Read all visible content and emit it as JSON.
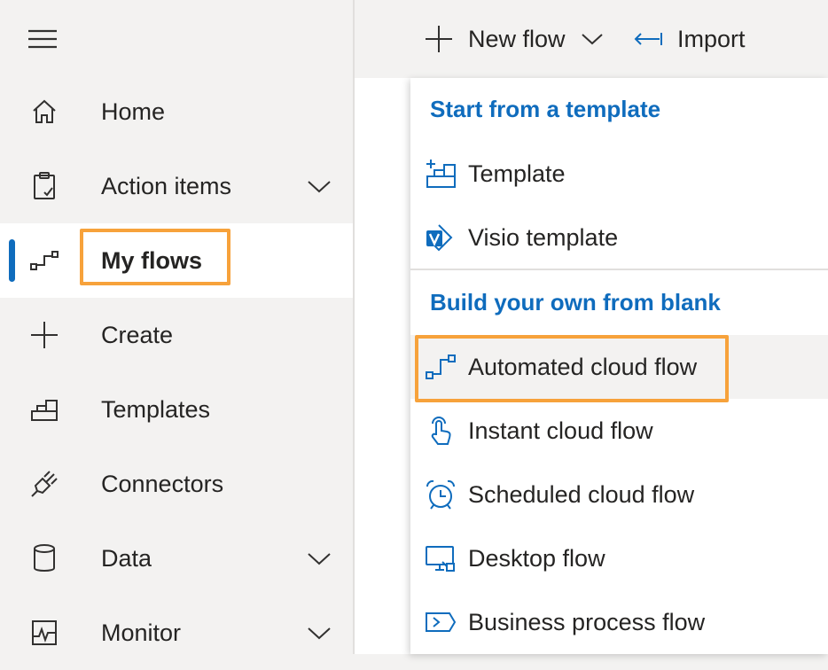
{
  "command_bar": {
    "new_flow_label": "New flow",
    "import_label": "Import"
  },
  "sidebar": {
    "items": [
      {
        "label": "Home",
        "icon": "home-icon"
      },
      {
        "label": "Action items",
        "icon": "clipboard-icon",
        "expandable": true
      },
      {
        "label": "My flows",
        "icon": "flow-icon",
        "active": true
      },
      {
        "label": "Create",
        "icon": "plus-icon"
      },
      {
        "label": "Templates",
        "icon": "templates-icon"
      },
      {
        "label": "Connectors",
        "icon": "plug-icon"
      },
      {
        "label": "Data",
        "icon": "database-icon",
        "expandable": true
      },
      {
        "label": "Monitor",
        "icon": "monitor-icon",
        "expandable": true
      }
    ]
  },
  "new_flow_menu": {
    "template_heading": "Start from a template",
    "template_items": [
      {
        "label": "Template",
        "icon": "template-icon"
      },
      {
        "label": "Visio template",
        "icon": "visio-icon"
      }
    ],
    "blank_heading": "Build your own from blank",
    "blank_items": [
      {
        "label": "Automated cloud flow",
        "icon": "automated-flow-icon",
        "highlighted": true
      },
      {
        "label": "Instant cloud flow",
        "icon": "touch-icon"
      },
      {
        "label": "Scheduled cloud flow",
        "icon": "alarm-clock-icon"
      },
      {
        "label": "Desktop flow",
        "icon": "desktop-flow-icon"
      },
      {
        "label": "Business process flow",
        "icon": "business-process-icon"
      }
    ]
  },
  "colors": {
    "accent": "#0f6cbd",
    "highlight": "#f7a23b",
    "sidebar_bg": "#f3f2f1"
  }
}
